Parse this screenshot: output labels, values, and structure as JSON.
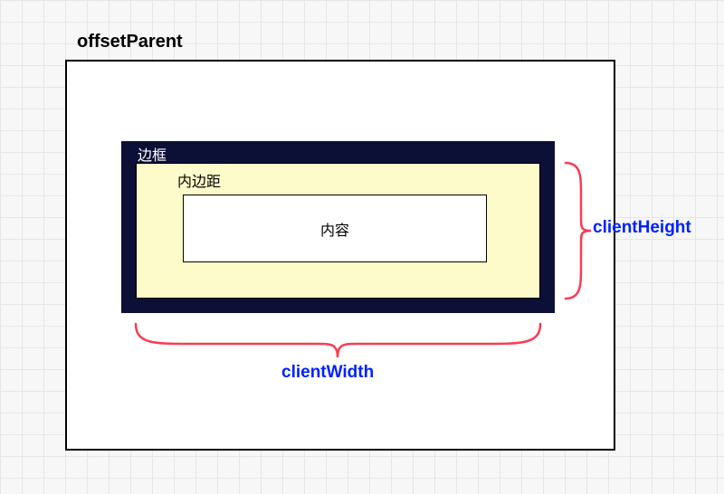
{
  "labels": {
    "offsetParent": "offsetParent",
    "border": "边框",
    "padding": "内边距",
    "content": "内容",
    "clientWidth": "clientWidth",
    "clientHeight": "clientHeight"
  },
  "colors": {
    "metric": "#0021ff",
    "brace": "#fb3b52",
    "borderBox": "#0c0f36",
    "paddingBox": "#fdfbc9",
    "grid": "#e6e6e8"
  },
  "diagram": {
    "concept": "CSS box model — clientWidth / clientHeight",
    "clientWidth_spans": "padding-box width (content + padding, excludes border)",
    "clientHeight_spans": "padding-box height (content + padding, excludes border)"
  }
}
